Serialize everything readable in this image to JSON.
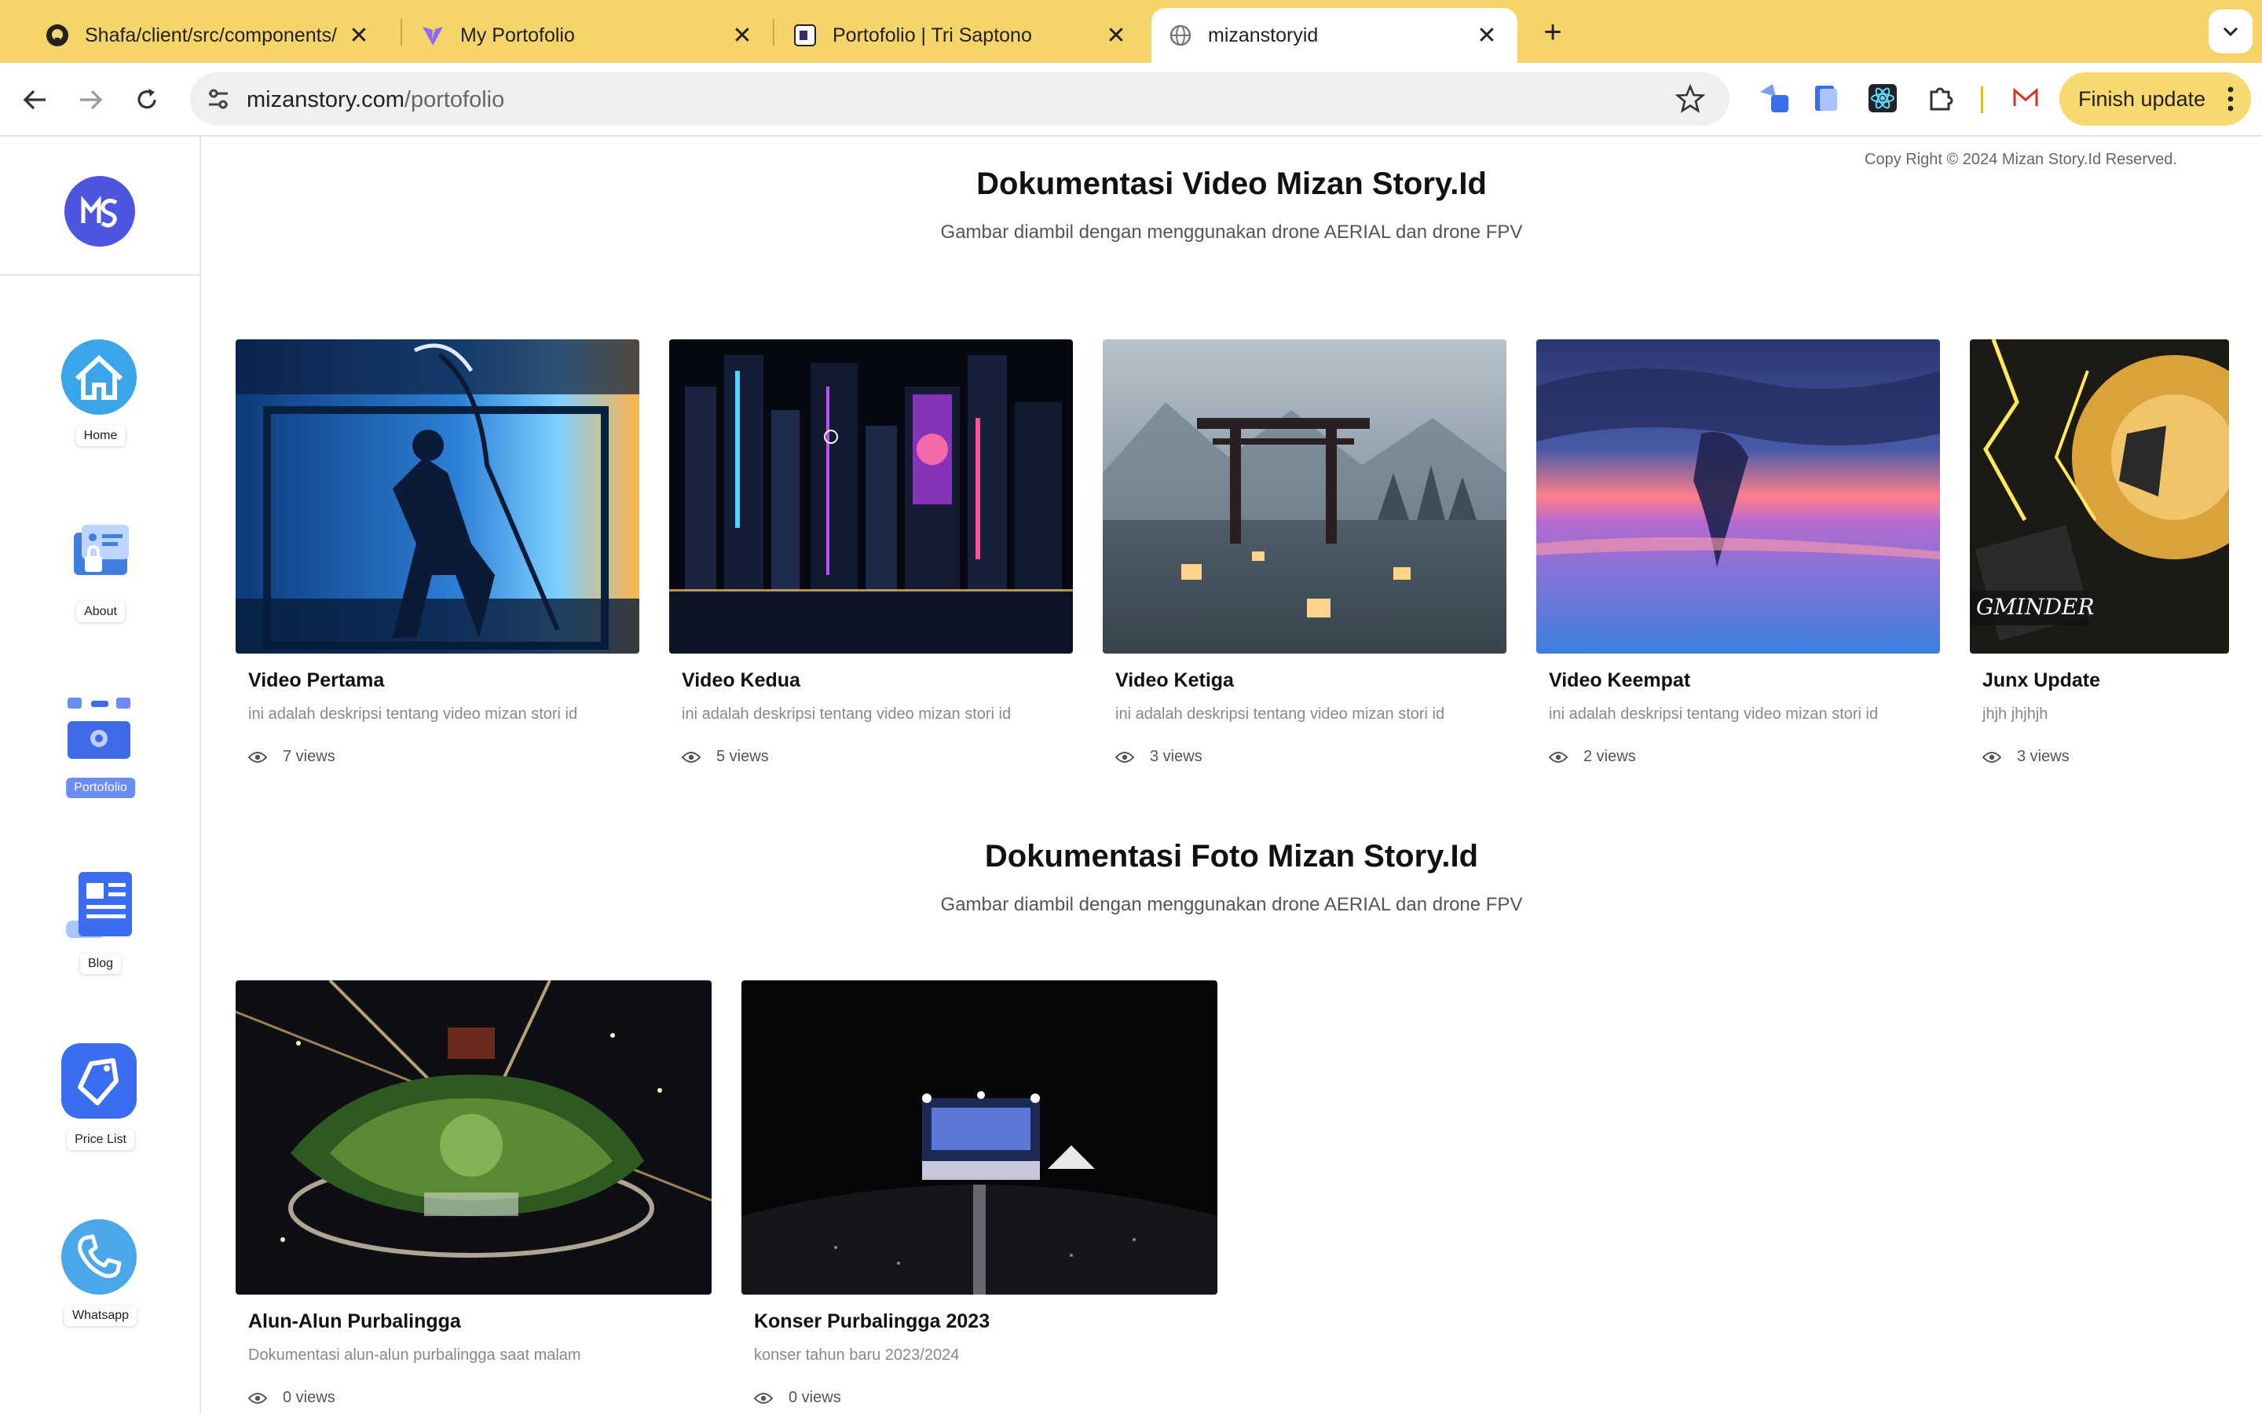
{
  "browser": {
    "tabs": [
      {
        "title": "Shafa/client/src/components/",
        "icon": "github-icon",
        "active": false
      },
      {
        "title": "My Portofolio",
        "icon": "vite-icon",
        "active": false
      },
      {
        "title": "Portofolio | Tri Saptono",
        "icon": "page-icon",
        "active": false
      },
      {
        "title": "mizanstoryid",
        "icon": "globe-icon",
        "active": true
      }
    ],
    "url_domain": "mizanstory.com",
    "url_path": "/portofolio",
    "update_button": "Finish update",
    "colors": {
      "tabbar": "#f5d56a",
      "update_button": "#f7d970"
    }
  },
  "sidebar": {
    "logo_icon": "mizan-story-logo",
    "items": [
      {
        "label": "Home",
        "icon": "home-icon",
        "active": false
      },
      {
        "label": "About",
        "icon": "about-icon",
        "active": false
      },
      {
        "label": "Portofolio",
        "icon": "portfolio-icon",
        "active": true
      },
      {
        "label": "Blog",
        "icon": "blog-icon",
        "active": false
      },
      {
        "label": "Price List",
        "icon": "price-tag-icon",
        "active": false
      },
      {
        "label": "Whatsapp",
        "icon": "phone-icon",
        "active": false
      }
    ],
    "active_color": "#6c8cf5"
  },
  "copyright": "Copy Right © 2024 Mizan Story.Id Reserved.",
  "video_section": {
    "title": "Dokumentasi Video Mizan Story.Id",
    "subtitle": "Gambar diambil dengan menggunakan drone AERIAL dan drone FPV",
    "cards": [
      {
        "title": "Video Pertama",
        "description": "ini adalah deskripsi tentang video mizan stori id",
        "views": "7 views"
      },
      {
        "title": "Video Kedua",
        "description": "ini adalah deskripsi tentang video mizan stori id",
        "views": "5 views"
      },
      {
        "title": "Video Ketiga",
        "description": "ini adalah deskripsi tentang video mizan stori id",
        "views": "3 views"
      },
      {
        "title": "Video Keempat",
        "description": "ini adalah deskripsi tentang video mizan stori id",
        "views": "2 views"
      },
      {
        "title": "Junx Update",
        "description": "jhjh jhjhjh",
        "views": "3 views"
      }
    ]
  },
  "photo_section": {
    "title": "Dokumentasi Foto Mizan Story.Id",
    "subtitle": "Gambar diambil dengan menggunakan drone AERIAL dan drone FPV",
    "cards": [
      {
        "title": "Alun-Alun Purbalingga",
        "description": "Dokumentasi alun-alun purbalingga saat malam",
        "views": "0 views"
      },
      {
        "title": "Konser Purbalingga 2023",
        "description": "konser tahun baru 2023/2024",
        "views": "0 views"
      }
    ]
  }
}
